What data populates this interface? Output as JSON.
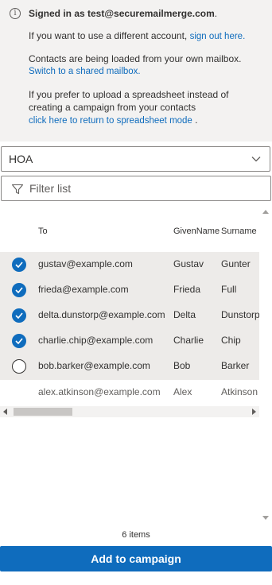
{
  "banner": {
    "signed_prefix": "Signed in as ",
    "signed_email": "test@securemailmerge.com",
    "signed_suffix": ".",
    "line1_text": "If you want to use a different account, ",
    "line1_link": "sign out here.",
    "line2_text": "Contacts are being loaded from your own mailbox.",
    "line2_link": "Switch to a shared mailbox.",
    "line3_text_a": "If you prefer to upload a spreadsheet instead of",
    "line3_text_b": "creating a campaign from your contacts",
    "line3_link": "click here to return to spreadsheet mode",
    "line3_suffix": " ."
  },
  "dropdown": {
    "value": "HOA"
  },
  "filter": {
    "placeholder": "Filter list",
    "value": ""
  },
  "table": {
    "columns": [
      "To",
      "GivenName",
      "Surname"
    ],
    "rows": [
      {
        "email": "gustav@example.com",
        "given": "Gustav",
        "surname": "Gunter",
        "selected": true
      },
      {
        "email": "frieda@example.com",
        "given": "Frieda",
        "surname": "Full",
        "selected": true
      },
      {
        "email": "delta.dunstorp@example.com",
        "given": "Delta",
        "surname": "Dunstorp",
        "selected": true
      },
      {
        "email": "charlie.chip@example.com",
        "given": "Charlie",
        "surname": "Chip",
        "selected": true
      },
      {
        "email": "bob.barker@example.com",
        "given": "Bob",
        "surname": "Barker",
        "selected": false
      },
      {
        "email": "alex.atkinson@example.com",
        "given": "Alex",
        "surname": "Atkinson",
        "selected": false
      }
    ]
  },
  "footer": {
    "count": "6 items",
    "add_button": "Add to campaign"
  },
  "colors": {
    "accent": "#0f6cbd",
    "banner_bg": "#f3f2f1",
    "selected_row": "#edebe9"
  }
}
